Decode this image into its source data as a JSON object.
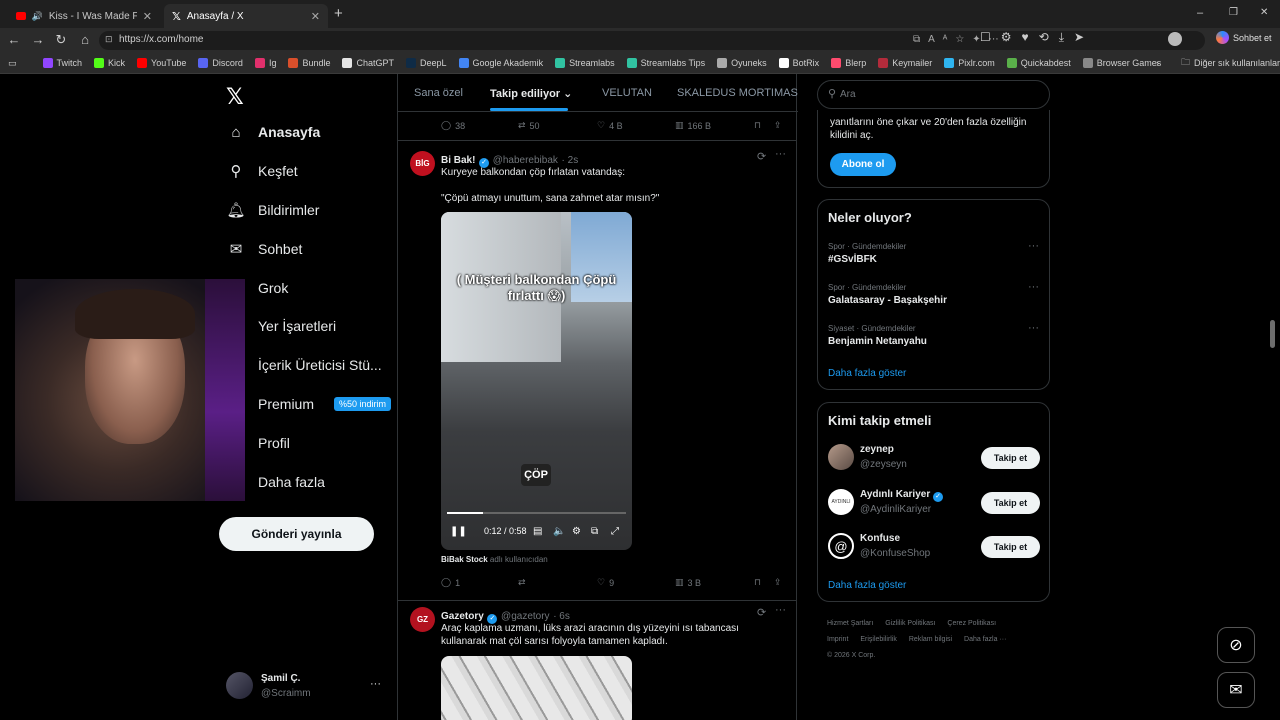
{
  "browser": {
    "tabs": [
      {
        "label": "Kiss - I Was Made For Lovin' Y"
      },
      {
        "label": "Anasayfa / X"
      }
    ],
    "new_tab": "+",
    "url": "https://x.com/home",
    "profile_label": "Sohbet et",
    "window_controls": [
      "–",
      "❐",
      "✕"
    ],
    "bookmarks": [
      {
        "label": "Twitch",
        "color": "#9146ff"
      },
      {
        "label": "Kick",
        "color": "#53fc18"
      },
      {
        "label": "YouTube",
        "color": "#ff0000"
      },
      {
        "label": "Discord",
        "color": "#5865f2"
      },
      {
        "label": "Ig",
        "color": "#e1306c"
      },
      {
        "label": "Bundle",
        "color": "#d94f2b"
      },
      {
        "label": "ChatGPT",
        "color": "#e5e5e5"
      },
      {
        "label": "DeepL",
        "color": "#0f2b46"
      },
      {
        "label": "Google Akademik",
        "color": "#4285f4"
      },
      {
        "label": "Streamlabs",
        "color": "#31c3a2"
      },
      {
        "label": "Streamlabs Tips",
        "color": "#31c3a2"
      },
      {
        "label": "Oyuneks",
        "color": "#aaaaaa"
      },
      {
        "label": "BotRix",
        "color": "#ffffff"
      },
      {
        "label": "Blerp",
        "color": "#ff4b6e"
      },
      {
        "label": "Keymailer",
        "color": "#b32b3b"
      },
      {
        "label": "Pixlr.com",
        "color": "#2fb5f0"
      },
      {
        "label": "Quickabdest",
        "color": "#5ab04a"
      },
      {
        "label": "Browser Games",
        "color": "#888888"
      }
    ],
    "more_bookmarks": "Diğer sık kullanılanlar"
  },
  "sidebar": {
    "items": [
      {
        "label": "Anasayfa",
        "icon": "home-icon"
      },
      {
        "label": "Keşfet",
        "icon": "search-icon"
      },
      {
        "label": "Bildirimler",
        "icon": "bell-icon"
      },
      {
        "label": "Sohbet",
        "icon": "mail-icon"
      },
      {
        "label": "Grok",
        "icon": "grok-icon"
      },
      {
        "label": "Yer İşaretleri",
        "icon": "bookmark-icon"
      },
      {
        "label": "İçerik Üreticisi Stü...",
        "icon": "studio-icon"
      },
      {
        "label": "Premium",
        "icon": "premium-icon",
        "badge": "%50 indirim"
      },
      {
        "label": "Profil",
        "icon": "person-icon"
      },
      {
        "label": "Daha fazla",
        "icon": "more-circle-icon"
      }
    ],
    "post_button": "Gönderi yayınla",
    "account": {
      "name": "Şamil Ç.",
      "handle": "@Scraimm",
      "more": "···"
    }
  },
  "feed": {
    "tabs": [
      "Sana özel",
      "Takip ediliyor",
      "VELUTAN",
      "SKALEDUS MORTIMAS"
    ],
    "active_tab": "Takip ediliyor",
    "prev_tweet_stats": {
      "replies": "38",
      "reposts": "50",
      "likes": "4 B",
      "views": "166 B"
    },
    "tweet1": {
      "name": "Bi Bak!",
      "handle": "@haberebibak",
      "time": "· 2s",
      "text1": "Kuryeye balkondan çöp fırlatan vatandaş:",
      "text2": "\"Çöpü atmayı unuttum, sana zahmet atar mısın?\"",
      "video_caption": "( Müşteri balkondan Çöpü  fırlattı 😱)",
      "video_label": "ÇÖP",
      "video_time": "0:12 / 0:58",
      "video_progress": 0.2,
      "source_name": "BiBak Stock",
      "source_suffix": "adlı kullanıcıdan",
      "stats": {
        "replies": "1",
        "reposts": "",
        "likes": "9",
        "views": "3 B"
      }
    },
    "tweet2": {
      "name": "Gazetory",
      "handle": "@gazetory",
      "time": "· 6s",
      "text": "Araç kaplama uzmanı, lüks arazi aracının dış yüzeyini ısı tabancası kullanarak mat çöl sarısı folyoyla tamamen kapladı."
    }
  },
  "right": {
    "search_placeholder": "Ara",
    "premium_text": "yanıtlarını öne çıkar ve 20'den fazla özelliğin kilidini aç.",
    "premium_button": "Abone ol",
    "trends_title": "Neler oluyor?",
    "trends": [
      {
        "category": "Spor · Gündemdekiler",
        "name": "#GSvİBFK"
      },
      {
        "category": "Spor · Gündemdekiler",
        "name": "Galatasaray - Başakşehir"
      },
      {
        "category": "Siyaset · Gündemdekiler",
        "name": "Benjamin Netanyahu"
      }
    ],
    "show_more": "Daha fazla göster",
    "follow_title": "Kimi takip etmeli",
    "follow": [
      {
        "name": "zeynep",
        "handle": "@zeyseyn",
        "verified": false
      },
      {
        "name": "Aydınlı Kariyer",
        "handle": "@AydinliKariyer",
        "verified": true
      },
      {
        "name": "Konfuse",
        "handle": "@KonfuseShop",
        "verified": false
      }
    ],
    "follow_button": "Takip et",
    "follow_show_more": "Daha fazla göster",
    "footer": [
      "Hizmet Şartları",
      "Gizlilik Politikası",
      "Çerez Politikası",
      "Imprint",
      "Erişilebilirlik",
      "Reklam bilgisi",
      "Daha fazla ···",
      "© 2026 X Corp."
    ]
  }
}
